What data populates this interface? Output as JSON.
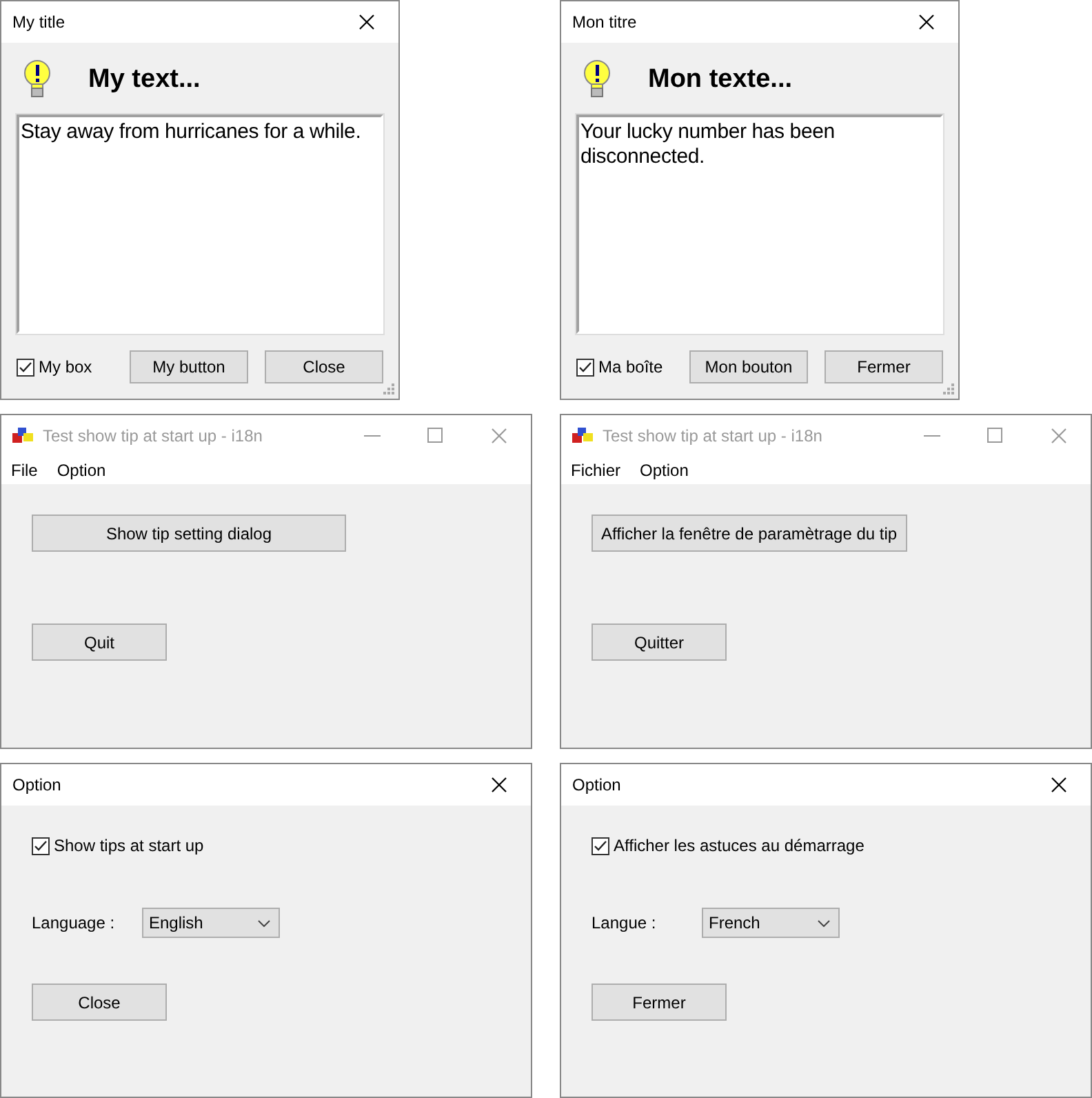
{
  "tip_dialogs": [
    {
      "title": "My title",
      "heading": "My text...",
      "message": "Stay away from hurricanes for a while.",
      "checkbox": {
        "label": "My box",
        "checked": true
      },
      "buttons": [
        "My button",
        "Close"
      ]
    },
    {
      "title": "Mon titre",
      "heading": "Mon texte...",
      "message": "Your lucky number has been disconnected.",
      "checkbox": {
        "label": "Ma boîte",
        "checked": true
      },
      "buttons": [
        "Mon bouton",
        "Fermer"
      ]
    }
  ],
  "main_windows": [
    {
      "title": "Test show tip at start up - i18n",
      "menu": [
        "File",
        "Option"
      ],
      "buttons": [
        "Show tip setting dialog",
        "Quit"
      ]
    },
    {
      "title": "Test show tip at start up - i18n",
      "menu": [
        "Fichier",
        "Option"
      ],
      "buttons": [
        "Afficher la fenêtre de paramètrage du tip",
        "Quitter"
      ]
    }
  ],
  "option_dialogs": [
    {
      "title": "Option",
      "checkbox": {
        "label": "Show tips at start up",
        "checked": true
      },
      "language_label": "Language :",
      "language_value": "English",
      "buttons": [
        "Close"
      ]
    },
    {
      "title": "Option",
      "checkbox": {
        "label": "Afficher les astuces au démarrage",
        "checked": true
      },
      "language_label": "Langue :",
      "language_value": "French",
      "buttons": [
        "Fermer"
      ]
    }
  ]
}
